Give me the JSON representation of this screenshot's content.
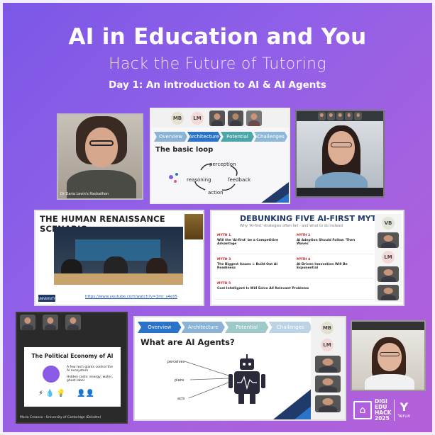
{
  "header": {
    "title": "AI in Education and You",
    "subtitle": "Hack the Future of Tutoring",
    "day": "Day 1: An introduction to AI & AI Agents"
  },
  "colors": {
    "accent": "#8a5be6",
    "navy": "#203a6a",
    "blue": "#2b73c8",
    "teal": "#4aa6a8"
  },
  "tiles": {
    "architecture": {
      "participants": [
        "MB",
        "LM"
      ],
      "nav": [
        "Overview",
        "Architecture",
        "Potential",
        "Challenges"
      ],
      "heading": "The basic loop",
      "loop": [
        "perception",
        "reasoning",
        "feedback",
        "action"
      ]
    },
    "renaissance": {
      "heading": "THE HUMAN RENAISSANCE SCENARIO",
      "link": "https://www.youtube.com/watch?v=3mr_s4eli5",
      "caption": "UNIVERSITY"
    },
    "myths": {
      "heading": "DEBUNKING FIVE AI-FIRST MYTHS",
      "sub": "Why 'AI-first' strategies often fail - and what to do instead",
      "participants": [
        "VB",
        "LM"
      ],
      "rows": [
        {
          "id": "MYTH 1",
          "title": "Will the 'AI-first' be a Competitive Advantage",
          "r": "MYTH 2",
          "rt": "AI Adoption Should Follow 'Then Waves'"
        },
        {
          "id": "MYTH 3",
          "title": "The Biggest Issues = Build Out AI Readiness",
          "r": "MYTH 4",
          "rt": "AI-Driven Innovation Will Be Exponential"
        },
        {
          "id": "MYTH 5",
          "title": "Cost Intelligent Is Will Solve All Relevant Problems",
          "r": "",
          "rt": ""
        }
      ]
    },
    "political": {
      "heading": "The Political Economy of AI",
      "bullets": [
        "A few tech giants control the AI ecosystem",
        "Hidden costs: energy, water, ghost labor"
      ],
      "name": "Maria Creanco - University of Cambridge (Deloitte)"
    },
    "agents": {
      "nav": [
        "Overview",
        "Architecture",
        "Potential",
        "Challenges"
      ],
      "heading": "What are AI Agents?",
      "labels": [
        "perceives",
        "plans",
        "acts"
      ],
      "participants": [
        "MB",
        "LM"
      ]
    },
    "speaker1": {
      "caption": "Dr Daria Levin's Hackathon"
    }
  },
  "logos": {
    "digi": [
      "DIGI",
      "EDU",
      "HACK",
      "2025"
    ],
    "yerun": "Yerun"
  }
}
